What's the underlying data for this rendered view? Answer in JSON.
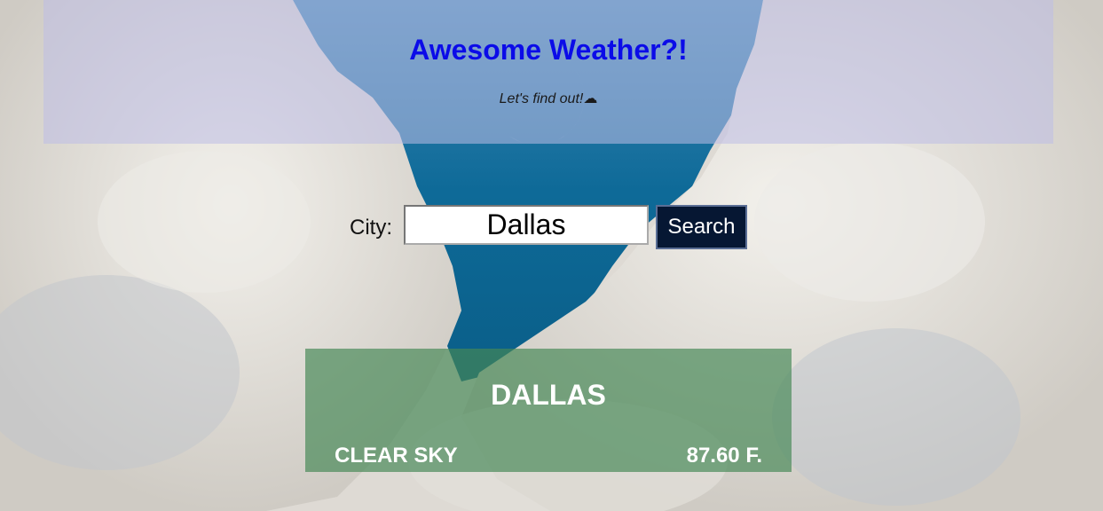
{
  "header": {
    "title": "Awesome Weather?!",
    "subtitle": "Let's find out!☁"
  },
  "search": {
    "label": "City:",
    "value": "Dallas",
    "button_label": "Search"
  },
  "result": {
    "city": "DALLAS",
    "condition": "CLEAR SKY",
    "temperature": "87.60 F."
  },
  "colors": {
    "title": "#0b0be8",
    "button_bg": "#061733",
    "card_bg": "#468755",
    "sky": "#1f6a96"
  }
}
